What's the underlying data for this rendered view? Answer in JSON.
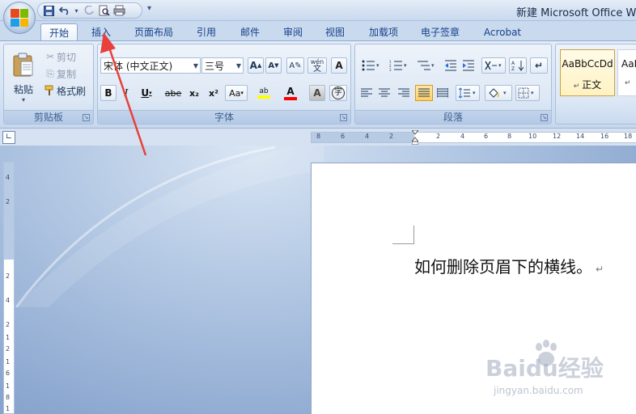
{
  "window": {
    "title": "新建 Microsoft Office Wo"
  },
  "tabs": [
    {
      "label": "开始",
      "active": true
    },
    {
      "label": "插入",
      "active": false
    },
    {
      "label": "页面布局",
      "active": false
    },
    {
      "label": "引用",
      "active": false
    },
    {
      "label": "邮件",
      "active": false
    },
    {
      "label": "审阅",
      "active": false
    },
    {
      "label": "视图",
      "active": false
    },
    {
      "label": "加载项",
      "active": false
    },
    {
      "label": "电子签章",
      "active": false
    },
    {
      "label": "Acrobat",
      "active": false
    }
  ],
  "clipboard": {
    "paste_label": "粘贴",
    "cut_label": "剪切",
    "copy_label": "复制",
    "format_painter_label": "格式刷",
    "group_label": "剪贴板"
  },
  "font": {
    "font_name": "宋体 (中文正文)",
    "font_size": "三号",
    "grow_glyph": "A",
    "shrink_glyph": "A",
    "bold_glyph": "B",
    "italic_glyph": "I",
    "underline_glyph": "U",
    "strike_glyph": "abe",
    "subscript_glyph": "x₂",
    "superscript_glyph": "x²",
    "change_case_glyph": "Aa",
    "highlight_glyph": "ab",
    "font_color_glyph": "A",
    "char_shading_glyph": "A",
    "enclose_glyph": "字",
    "phonetic_glyph": "wén",
    "phonetic_base_glyph": "文",
    "char_border_glyph": "A",
    "group_label": "字体"
  },
  "paragraph": {
    "group_label": "段落"
  },
  "styles": {
    "items": [
      {
        "preview": "AaBbCcDd",
        "name": "正文"
      },
      {
        "preview": "AaI",
        "name": ""
      }
    ]
  },
  "document": {
    "text": "如何删除页眉下的横线。",
    "para_mark": "↵"
  },
  "watermark": {
    "main": "Baidu经验",
    "sub": "jingyan.baidu.com"
  },
  "ruler": {
    "h_ticks": [
      "8",
      "6",
      "4",
      "2",
      "2",
      "4",
      "6",
      "8",
      "10",
      "12",
      "14",
      "16",
      "18"
    ],
    "v_ticks": [
      "4",
      "2",
      "2",
      "4",
      "2",
      "1",
      "2",
      "1",
      "6",
      "1",
      "8",
      "1"
    ]
  },
  "colors": {
    "highlight": "#ffff00",
    "font_color": "#ff0000",
    "accent": "#15428b",
    "arrow": "#e8403a"
  }
}
